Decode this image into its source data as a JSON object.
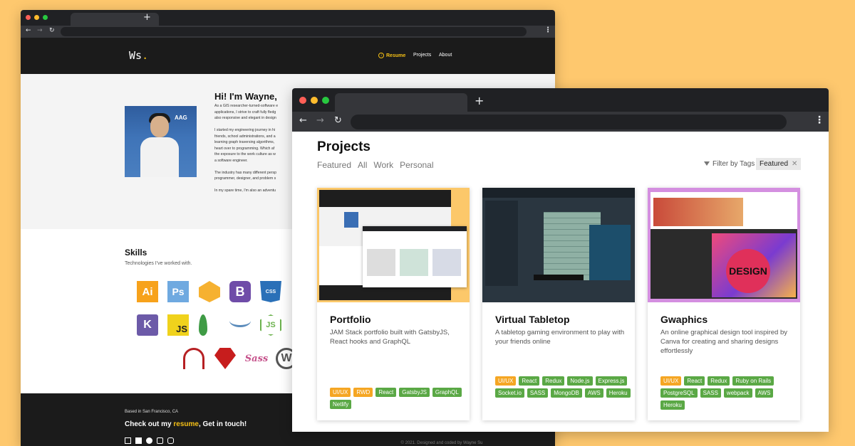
{
  "colors": {
    "background": "#fec86e",
    "accent_yellow": "#f5c016",
    "tag_orange": "#f5a623",
    "tag_green": "#5aa845",
    "dark": "#1b1b1b"
  },
  "back_browser": {
    "new_tab": "+",
    "kebab": "⋮",
    "nav_icons": {
      "back": "←",
      "forward": "→",
      "reload": "↻"
    },
    "header": {
      "logo": "Ws",
      "logo_dot": ".",
      "nav": {
        "resume": "Resume",
        "projects": "Projects",
        "about": "About"
      }
    },
    "hero": {
      "title": "Hi! I'm Wayne,",
      "photo_text": "AAG",
      "bio_lines": [
        "As a GIS researcher-turned-software e",
        "applications, I strive to craft fully fledg",
        "also responsive and elegant in design",
        "I started my engineering journey in hi",
        "friends, school administrations, and a",
        "learning graph traversing algorithms,",
        "heart over to programming. Which af",
        "the exposure to the work culture as w",
        "a software engineer.",
        "The industry has many different persp",
        "programmer, designer, and problem s",
        "In my spare time, I'm also an adventu"
      ]
    },
    "skills": {
      "title": "Skills",
      "subtitle": "Technologies I've worked with.",
      "icons": [
        {
          "name": "illustrator-icon",
          "label": "Ai"
        },
        {
          "name": "photoshop-icon",
          "label": "Ps"
        },
        {
          "name": "aws-icon",
          "label": ""
        },
        {
          "name": "bootstrap-icon",
          "label": "B"
        },
        {
          "name": "css3-icon",
          "label": "CSS"
        },
        {
          "name": "heroku-icon",
          "label": "K"
        },
        {
          "name": "javascript-icon",
          "label": "JS"
        },
        {
          "name": "mongodb-icon",
          "label": ""
        },
        {
          "name": "mysql-icon",
          "label": ""
        },
        {
          "name": "nodejs-icon",
          "label": "JS"
        },
        {
          "name": "rails-icon",
          "label": ""
        },
        {
          "name": "ruby-icon",
          "label": ""
        },
        {
          "name": "sass-icon",
          "label": "Sass"
        },
        {
          "name": "wordpress-icon",
          "label": "W"
        }
      ]
    },
    "footer": {
      "location": "Based in San Francisco, CA",
      "cta_prefix": "Check out my ",
      "cta_link": "resume",
      "cta_suffix": ", Get in touch!",
      "copyright": "© 2021. Designed and coded by Wayne Su"
    }
  },
  "front_browser": {
    "new_tab": "+",
    "kebab": "⋮",
    "nav_icons": {
      "back": "←",
      "forward": "→",
      "reload": "↻"
    },
    "page": {
      "title": "Projects",
      "filters": [
        "Featured",
        "All",
        "Work",
        "Personal"
      ],
      "filter_label": "Filter by Tags",
      "active_chip": "Featured",
      "chip_close": "✕",
      "projects": [
        {
          "title": "Portfolio",
          "description": "JAM Stack portfolio built with GatsbyJS, React hooks and GraphQL",
          "tags": [
            {
              "label": "UI/UX",
              "color": "orange"
            },
            {
              "label": "RWD",
              "color": "orange"
            },
            {
              "label": "React",
              "color": "green"
            },
            {
              "label": "GatsbyJS",
              "color": "green"
            },
            {
              "label": "GraphQL",
              "color": "green"
            },
            {
              "label": "Netlify",
              "color": "green"
            }
          ]
        },
        {
          "title": "Virtual Tabletop",
          "description": "A tabletop gaming environment to play with your friends online",
          "tags": [
            {
              "label": "UI/UX",
              "color": "orange"
            },
            {
              "label": "React",
              "color": "green"
            },
            {
              "label": "Redux",
              "color": "green"
            },
            {
              "label": "Node.js",
              "color": "green"
            },
            {
              "label": "Express.js",
              "color": "green"
            },
            {
              "label": "Socket.io",
              "color": "green"
            },
            {
              "label": "SASS",
              "color": "green"
            },
            {
              "label": "MongoDB",
              "color": "green"
            },
            {
              "label": "AWS",
              "color": "green"
            },
            {
              "label": "Heroku",
              "color": "green"
            }
          ]
        },
        {
          "title": "Gwaphics",
          "description": "An online graphical design tool inspired by Canva for creating and sharing designs effortlessly",
          "thumb_text": "DESIGN",
          "tags": [
            {
              "label": "UI/UX",
              "color": "orange"
            },
            {
              "label": "React",
              "color": "green"
            },
            {
              "label": "Redux",
              "color": "green"
            },
            {
              "label": "Ruby on Rails",
              "color": "green"
            },
            {
              "label": "PostgreSQL",
              "color": "green"
            },
            {
              "label": "SASS",
              "color": "green"
            },
            {
              "label": "webpack",
              "color": "green"
            },
            {
              "label": "AWS",
              "color": "green"
            },
            {
              "label": "Heroku",
              "color": "green"
            }
          ]
        }
      ]
    }
  }
}
